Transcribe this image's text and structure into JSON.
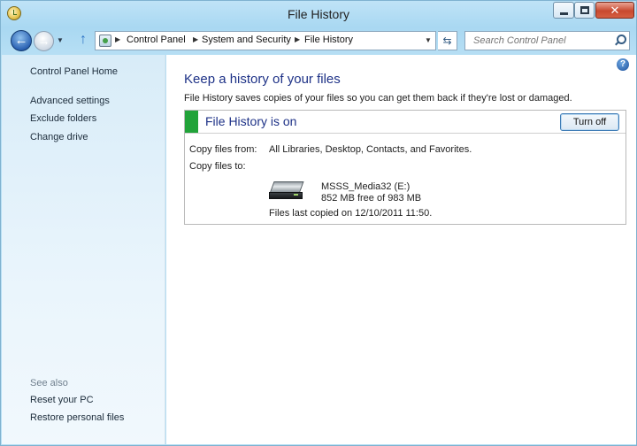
{
  "window": {
    "title": "File History"
  },
  "address_bar": {
    "breadcrumbs": [
      "Control Panel",
      "System and Security",
      "File History"
    ]
  },
  "search": {
    "placeholder": "Search Control Panel"
  },
  "sidebar": {
    "links": [
      "Control Panel Home",
      "Advanced settings",
      "Exclude folders",
      "Change drive"
    ],
    "see_also_label": "See also",
    "see_also_links": [
      "Reset your PC",
      "Restore personal files"
    ]
  },
  "main": {
    "heading": "Keep a history of your files",
    "description": "File History saves copies of your files so you can get them back if they're lost or damaged.",
    "status": {
      "title": "File History is on",
      "color": "#21a339",
      "turn_off_label": "Turn off"
    },
    "copy_from_label": "Copy files from:",
    "copy_from_value": "All Libraries, Desktop, Contacts, and Favorites.",
    "copy_to_label": "Copy files to:",
    "drive": {
      "icon": "drive-icon",
      "name": "MSSS_Media32 (E:)",
      "free_space": "852 MB free of 983 MB"
    },
    "last_copied": "Files last copied on 12/10/2011 11:50."
  },
  "colors": {
    "link": "#1b2b3a",
    "heading": "#1e3287",
    "window_frame": "#a9d8f2"
  }
}
